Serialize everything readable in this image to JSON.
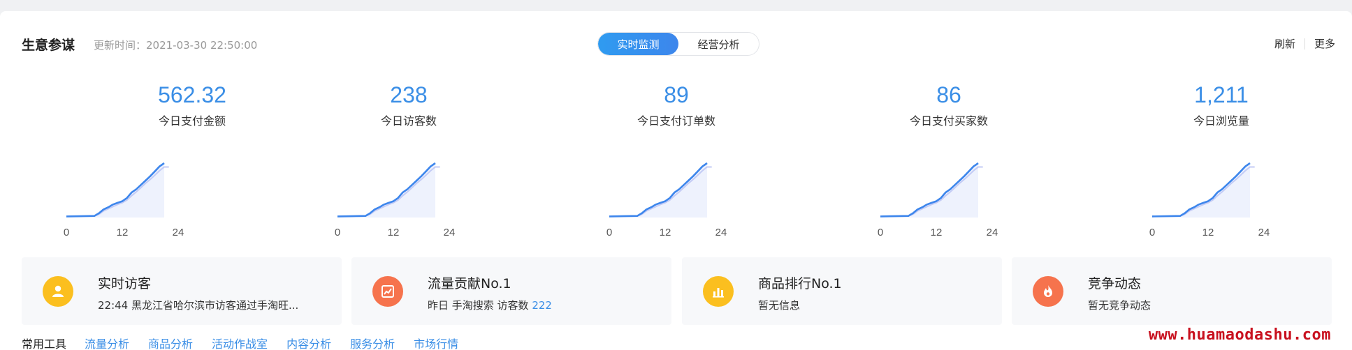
{
  "header": {
    "title": "生意参谋",
    "update_time": "更新时间：2021-03-30 22:50:00",
    "tabs": [
      {
        "label": "实时监测",
        "active": true
      },
      {
        "label": "经营分析",
        "active": false
      }
    ],
    "refresh_label": "刷新",
    "more_label": "更多"
  },
  "metrics": [
    {
      "value": "562.32",
      "label": "今日支付金额"
    },
    {
      "value": "238",
      "label": "今日访客数"
    },
    {
      "value": "89",
      "label": "今日支付订单数"
    },
    {
      "value": "86",
      "label": "今日支付买家数"
    },
    {
      "value": "1,211",
      "label": "今日浏览量"
    }
  ],
  "sparkline": {
    "x_ticks": [
      "0",
      "12",
      "24"
    ],
    "x_range": [
      0,
      24
    ],
    "today": [
      [
        0,
        0.02
      ],
      [
        6,
        0.03
      ],
      [
        7,
        0.08
      ],
      [
        8,
        0.15
      ],
      [
        9,
        0.19
      ],
      [
        10,
        0.24
      ],
      [
        11,
        0.27
      ],
      [
        12,
        0.3
      ],
      [
        13,
        0.36
      ],
      [
        14,
        0.46
      ],
      [
        15,
        0.52
      ],
      [
        16,
        0.6
      ],
      [
        17,
        0.68
      ],
      [
        18,
        0.76
      ],
      [
        19,
        0.85
      ],
      [
        20,
        0.94
      ],
      [
        21,
        1.0
      ]
    ],
    "yesterday": [
      [
        0,
        0.02
      ],
      [
        6,
        0.03
      ],
      [
        7,
        0.06
      ],
      [
        8,
        0.12
      ],
      [
        9,
        0.16
      ],
      [
        10,
        0.2
      ],
      [
        11,
        0.24
      ],
      [
        12,
        0.27
      ],
      [
        13,
        0.32
      ],
      [
        14,
        0.4
      ],
      [
        15,
        0.47
      ],
      [
        16,
        0.55
      ],
      [
        17,
        0.63
      ],
      [
        18,
        0.7
      ],
      [
        19,
        0.78
      ],
      [
        20,
        0.86
      ],
      [
        21,
        0.93
      ],
      [
        22,
        0.93
      ]
    ],
    "colors": {
      "today": "#3d86ec",
      "yesterday": "#c3cbf5",
      "fill": "#eef2fd"
    }
  },
  "cards": [
    {
      "title": "实时访客",
      "sub": "22:44 黑龙江省哈尔滨市访客通过手淘旺...",
      "highlight": "",
      "icon": "user-icon",
      "color": "#fbbf1f"
    },
    {
      "title": "流量贡献No.1",
      "sub": "昨日 手淘搜索 访客数 ",
      "highlight": "222",
      "icon": "trend-icon",
      "color": "#f6734d"
    },
    {
      "title": "商品排行No.1",
      "sub": "暂无信息",
      "highlight": "",
      "icon": "bar-chart-icon",
      "color": "#fbbf1f"
    },
    {
      "title": "竞争动态",
      "sub": "暂无竞争动态",
      "highlight": "",
      "icon": "flame-icon",
      "color": "#f6734d"
    }
  ],
  "toolbar": {
    "label": "常用工具",
    "links": [
      "流量分析",
      "商品分析",
      "活动作战室",
      "内容分析",
      "服务分析",
      "市场行情"
    ]
  },
  "watermark": "www.huamaodashu.com"
}
